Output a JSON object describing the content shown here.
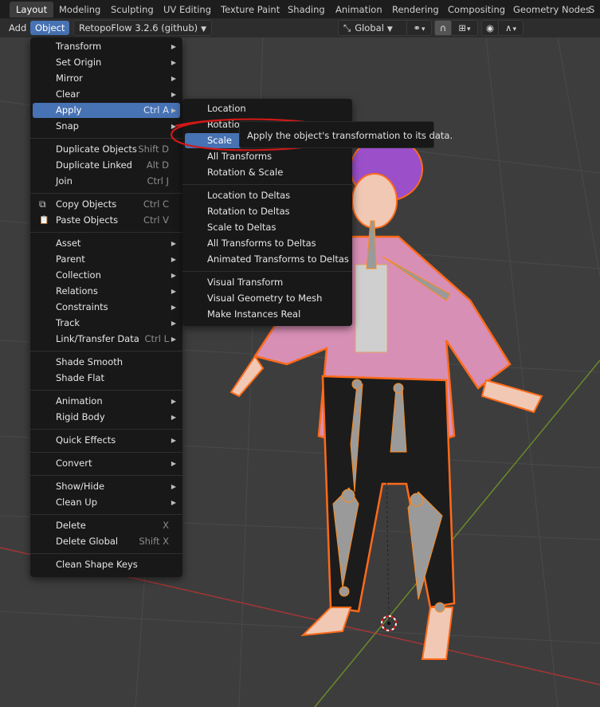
{
  "workspace_tabs": [
    "Layout",
    "Modeling",
    "Sculpting",
    "UV Editing",
    "Texture Paint",
    "Shading",
    "Animation",
    "Rendering",
    "Compositing",
    "Geometry Nodes",
    "S"
  ],
  "header": {
    "add": "Add",
    "object": "Object",
    "addon_dropdown": "RetopoFlow 3.2.6 (github)",
    "orientation": "Global"
  },
  "object_menu": [
    {
      "label": "Transform",
      "submenu": true
    },
    {
      "label": "Set Origin",
      "submenu": true
    },
    {
      "label": "Mirror",
      "submenu": true
    },
    {
      "label": "Clear",
      "submenu": true
    },
    {
      "label": "Apply",
      "shortcut": "Ctrl A",
      "submenu": true,
      "highlight": true
    },
    {
      "label": "Snap",
      "submenu": true
    },
    {
      "sep": true
    },
    {
      "label": "Duplicate Objects",
      "shortcut": "Shift D"
    },
    {
      "label": "Duplicate Linked",
      "shortcut": "Alt D"
    },
    {
      "label": "Join",
      "shortcut": "Ctrl J"
    },
    {
      "sep": true
    },
    {
      "label": "Copy Objects",
      "shortcut": "Ctrl C",
      "icon": "copy-icon"
    },
    {
      "label": "Paste Objects",
      "shortcut": "Ctrl V",
      "icon": "paste-icon"
    },
    {
      "sep": true
    },
    {
      "label": "Asset",
      "submenu": true
    },
    {
      "label": "Parent",
      "submenu": true
    },
    {
      "label": "Collection",
      "submenu": true
    },
    {
      "label": "Relations",
      "submenu": true
    },
    {
      "label": "Constraints",
      "submenu": true
    },
    {
      "label": "Track",
      "submenu": true
    },
    {
      "label": "Link/Transfer Data",
      "shortcut": "Ctrl L",
      "submenu": true
    },
    {
      "sep": true
    },
    {
      "label": "Shade Smooth"
    },
    {
      "label": "Shade Flat"
    },
    {
      "sep": true
    },
    {
      "label": "Animation",
      "submenu": true
    },
    {
      "label": "Rigid Body",
      "submenu": true
    },
    {
      "sep": true
    },
    {
      "label": "Quick Effects",
      "submenu": true
    },
    {
      "sep": true
    },
    {
      "label": "Convert",
      "submenu": true
    },
    {
      "sep": true
    },
    {
      "label": "Show/Hide",
      "submenu": true
    },
    {
      "label": "Clean Up",
      "submenu": true
    },
    {
      "sep": true
    },
    {
      "label": "Delete",
      "shortcut": "X"
    },
    {
      "label": "Delete Global",
      "shortcut": "Shift X"
    },
    {
      "sep": true
    },
    {
      "label": "Clean Shape Keys"
    }
  ],
  "apply_menu": [
    {
      "label": "Location"
    },
    {
      "label": "Rotation"
    },
    {
      "label": "Scale",
      "highlight": true
    },
    {
      "label": "All Transforms"
    },
    {
      "label": "Rotation & Scale"
    },
    {
      "sep": true
    },
    {
      "label": "Location to Deltas"
    },
    {
      "label": "Rotation to Deltas"
    },
    {
      "label": "Scale to Deltas"
    },
    {
      "label": "All Transforms to Deltas"
    },
    {
      "label": "Animated Transforms to Deltas"
    },
    {
      "sep": true
    },
    {
      "label": "Visual Transform"
    },
    {
      "label": "Visual Geometry to Mesh"
    },
    {
      "label": "Make Instances Real"
    }
  ],
  "tooltip": "Apply the object's transformation to its data.",
  "colors": {
    "highlight": "#4772b3",
    "annotation": "#d01818",
    "outline": "#ff6a1a"
  }
}
